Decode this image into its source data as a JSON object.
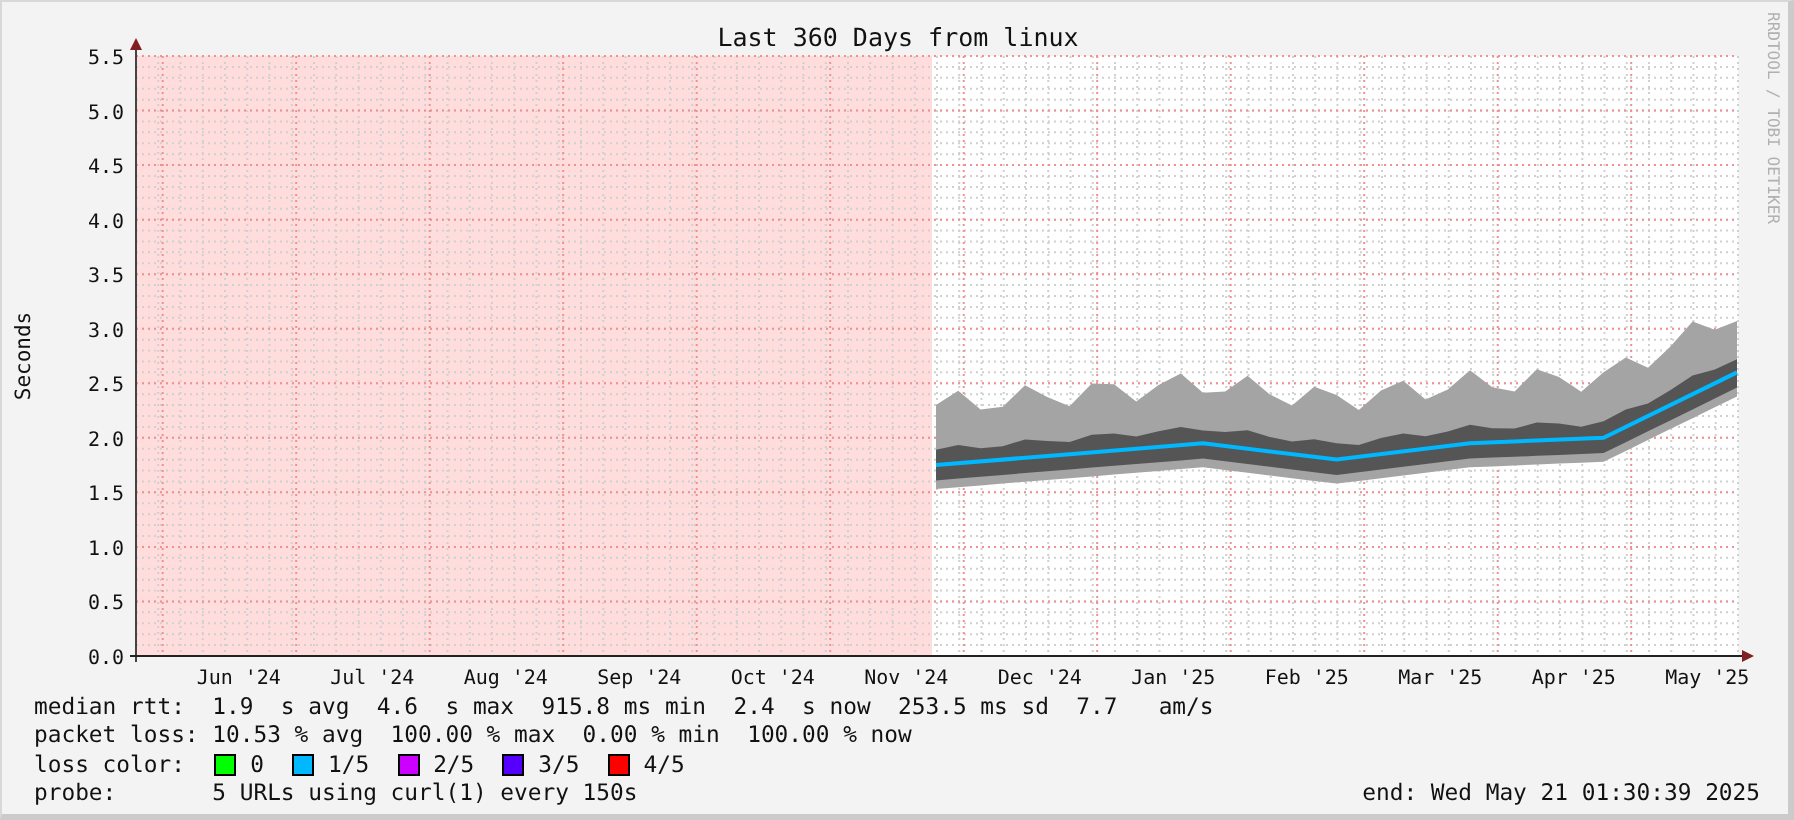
{
  "graph": {
    "title": "Last 360 Days from linux",
    "side_text": "RRDTOOL / TOBI OETIKER",
    "chart_data": {
      "type": "line",
      "ylabel": "Seconds",
      "grid": true,
      "ylim": [
        0,
        5.5
      ],
      "categories": [
        "Jun '24",
        "Jul '24",
        "Aug '24",
        "Sep '24",
        "Oct '24",
        "Nov '24",
        "Dec '24",
        "Jan '25",
        "Feb '25",
        "Mar '25",
        "Apr '25",
        "May '25"
      ],
      "series": [
        {
          "color": "#00b8ff",
          "values": [
            null,
            null,
            null,
            null,
            null,
            1.75,
            1.85,
            1.95,
            1.8,
            1.95,
            2.0,
            2.6
          ]
        }
      ],
      "yticks": [
        {
          "value": 0,
          "label": "0.0"
        },
        {
          "value": 0.5,
          "label": "0.5"
        },
        {
          "value": 1,
          "label": "1.0"
        },
        {
          "value": 1.5,
          "label": "1.5"
        },
        {
          "value": 2,
          "label": "2.0"
        },
        {
          "value": 2.5,
          "label": "2.5"
        },
        {
          "value": 3,
          "label": "3.0"
        },
        {
          "value": 3.5,
          "label": "3.5"
        },
        {
          "value": 4,
          "label": "4.0"
        },
        {
          "value": 4.5,
          "label": "4.5"
        },
        {
          "value": 5,
          "label": "5.0"
        },
        {
          "value": 5.5,
          "label": "5.5"
        }
      ]
    }
  },
  "legend": {
    "rows": [
      {
        "kind": "text",
        "label": "median rtt:",
        "value": "1.9  s avg  4.6  s max  915.8 ms min  2.4  s now  253.5 ms sd  7.7   am/s"
      },
      {
        "kind": "text",
        "label": "packet loss:",
        "value": "10.53 % avg  100.00 % max  0.00 % min  100.00 % now"
      },
      {
        "kind": "swatches",
        "label": "loss color:",
        "items": [
          {
            "label": "0",
            "color": "#00ff00"
          },
          {
            "label": "1/5",
            "color": "#00b8ff"
          },
          {
            "label": "2/5",
            "color": "#cc00ff"
          },
          {
            "label": "3/5",
            "color": "#5500ff"
          },
          {
            "label": "4/5",
            "color": "#ff0000"
          }
        ]
      },
      {
        "kind": "text",
        "label": "probe:",
        "value": "5 URLs using curl(1) every 150s"
      }
    ],
    "end": "end: Wed May 21 01:30:39 2025"
  }
}
